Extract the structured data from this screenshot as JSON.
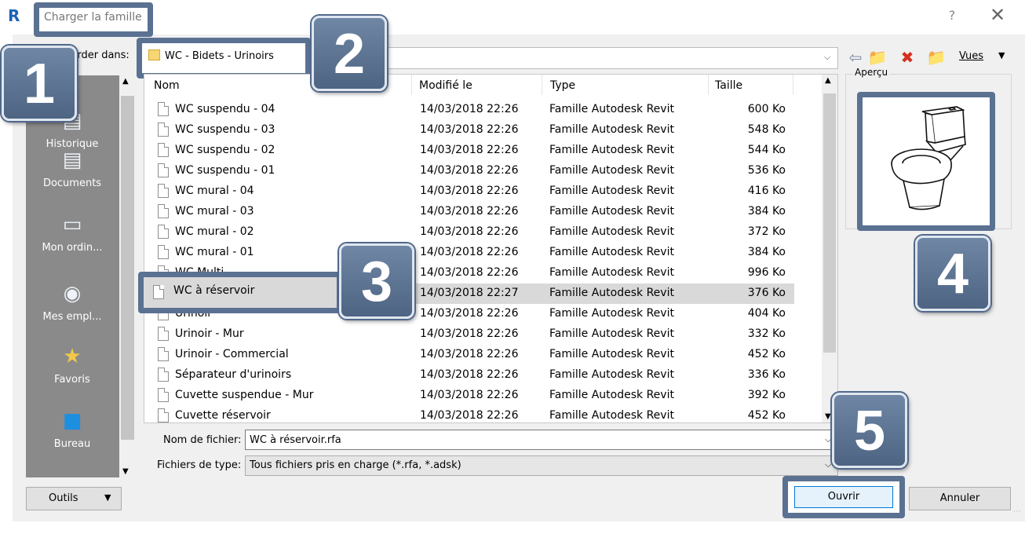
{
  "window": {
    "title": "Charger la famille",
    "help_glyph": "?",
    "close_glyph": "✕"
  },
  "look_in": {
    "label": "...arder dans:",
    "path": "WC - Bidets - Urinoirs"
  },
  "toolbar": {
    "views_label": "Vues"
  },
  "places": [
    {
      "label": "Historique",
      "icon": "history-icon"
    },
    {
      "label": "Documents",
      "icon": "documents-icon"
    },
    {
      "label": "Mon ordin...",
      "icon": "computer-icon"
    },
    {
      "label": "Mes empl...",
      "icon": "network-places-icon"
    },
    {
      "label": "Favoris",
      "icon": "favorites-icon"
    },
    {
      "label": "Bureau",
      "icon": "desktop-icon"
    }
  ],
  "file_list": {
    "columns": [
      "Nom",
      "Modifié le",
      "Type",
      "Taille"
    ],
    "rows": [
      {
        "name": "WC suspendu - 04",
        "date": "14/03/2018 22:26",
        "type": "Famille Autodesk Revit",
        "size": "600 Ko"
      },
      {
        "name": "WC suspendu - 03",
        "date": "14/03/2018 22:26",
        "type": "Famille Autodesk Revit",
        "size": "548 Ko"
      },
      {
        "name": "WC suspendu - 02",
        "date": "14/03/2018 22:26",
        "type": "Famille Autodesk Revit",
        "size": "544 Ko"
      },
      {
        "name": "WC suspendu - 01",
        "date": "14/03/2018 22:26",
        "type": "Famille Autodesk Revit",
        "size": "536 Ko"
      },
      {
        "name": "WC mural - 04",
        "date": "14/03/2018 22:26",
        "type": "Famille Autodesk Revit",
        "size": "416 Ko"
      },
      {
        "name": "WC mural - 03",
        "date": "14/03/2018 22:26",
        "type": "Famille Autodesk Revit",
        "size": "384 Ko"
      },
      {
        "name": "WC mural - 02",
        "date": "14/03/2018 22:26",
        "type": "Famille Autodesk Revit",
        "size": "372 Ko"
      },
      {
        "name": "WC mural - 01",
        "date": "14/03/2018 22:26",
        "type": "Famille Autodesk Revit",
        "size": "384 Ko"
      },
      {
        "name": "WC Multi",
        "date": "14/03/2018 22:26",
        "type": "Famille Autodesk Revit",
        "size": "996 Ko"
      },
      {
        "name": "WC à réservoir",
        "date": "14/03/2018 22:27",
        "type": "Famille Autodesk Revit",
        "size": "376 Ko",
        "selected": true
      },
      {
        "name": "Urinoir",
        "date": "14/03/2018 22:26",
        "type": "Famille Autodesk Revit",
        "size": "404 Ko"
      },
      {
        "name": "Urinoir - Mur",
        "date": "14/03/2018 22:26",
        "type": "Famille Autodesk Revit",
        "size": "332 Ko"
      },
      {
        "name": "Urinoir - Commercial",
        "date": "14/03/2018 22:26",
        "type": "Famille Autodesk Revit",
        "size": "452 Ko"
      },
      {
        "name": "Séparateur d'urinoirs",
        "date": "14/03/2018 22:26",
        "type": "Famille Autodesk Revit",
        "size": "336 Ko"
      },
      {
        "name": "Cuvette suspendue - Mur",
        "date": "14/03/2018 22:26",
        "type": "Famille Autodesk Revit",
        "size": "392 Ko"
      },
      {
        "name": "Cuvette réservoir",
        "date": "14/03/2018 22:26",
        "type": "Famille Autodesk Revit",
        "size": "452 Ko"
      }
    ]
  },
  "preview": {
    "label": "Aperçu"
  },
  "file_name": {
    "label": "Nom de fichier:",
    "value": "WC à réservoir.rfa"
  },
  "file_type": {
    "label": "Fichiers de type:",
    "value": "Tous fichiers pris en charge  (*.rfa, *.adsk)"
  },
  "buttons": {
    "tools": "Outils",
    "open": "Ouvrir",
    "cancel": "Annuler"
  },
  "badges": [
    "1",
    "2",
    "3",
    "4",
    "5"
  ],
  "colors": {
    "callout_frame": "#5a7191",
    "badge_fill": "#5f7897",
    "selection": "#d9d9d9",
    "places_bar": "#8a8a8a"
  }
}
